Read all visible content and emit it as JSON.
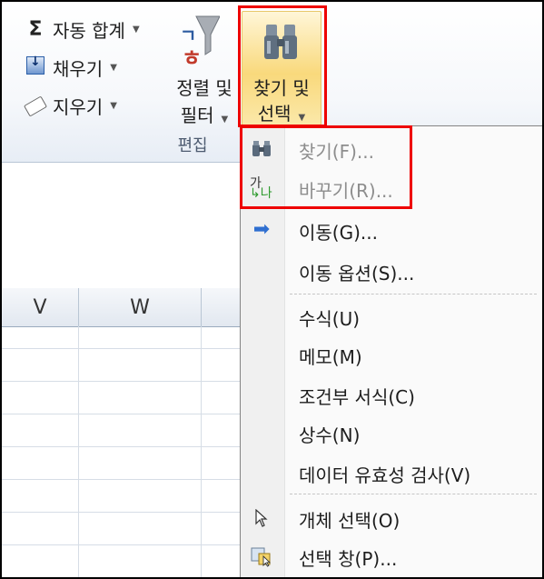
{
  "ribbon": {
    "autosum": {
      "icon": "sigma-icon",
      "label": "자동 합계"
    },
    "fill": {
      "icon": "fill-down-icon",
      "label": "채우기"
    },
    "clear": {
      "icon": "eraser-icon",
      "label": "지우기"
    },
    "sort_filter": {
      "line1": "정렬 및",
      "line2": "필터"
    },
    "find_select": {
      "line1": "찾기 및",
      "line2": "선택"
    },
    "group_label": "편집"
  },
  "sheet": {
    "columns": [
      "V",
      "W"
    ]
  },
  "menu": {
    "items": [
      {
        "label": "찾기(F)...",
        "icon": "binoculars-icon",
        "enabled": false
      },
      {
        "label": "바꾸기(R)...",
        "icon": "replace-icon",
        "enabled": false
      },
      {
        "label": "이동(G)...",
        "icon": "arrow-right-icon",
        "enabled": true
      },
      {
        "label": "이동 옵션(S)...",
        "icon": "",
        "enabled": true
      },
      {
        "label": "수식(U)",
        "icon": "",
        "enabled": true
      },
      {
        "label": "메모(M)",
        "icon": "",
        "enabled": true
      },
      {
        "label": "조건부 서식(C)",
        "icon": "",
        "enabled": true
      },
      {
        "label": "상수(N)",
        "icon": "",
        "enabled": true
      },
      {
        "label": "데이터 유효성 검사(V)",
        "icon": "",
        "enabled": true
      },
      {
        "label": "개체 선택(O)",
        "icon": "cursor-icon",
        "enabled": true
      },
      {
        "label": "선택 창(P)...",
        "icon": "selection-pane-icon",
        "enabled": true
      }
    ]
  },
  "colors": {
    "highlight": "#e00000",
    "accent": "#2a5ea8"
  }
}
